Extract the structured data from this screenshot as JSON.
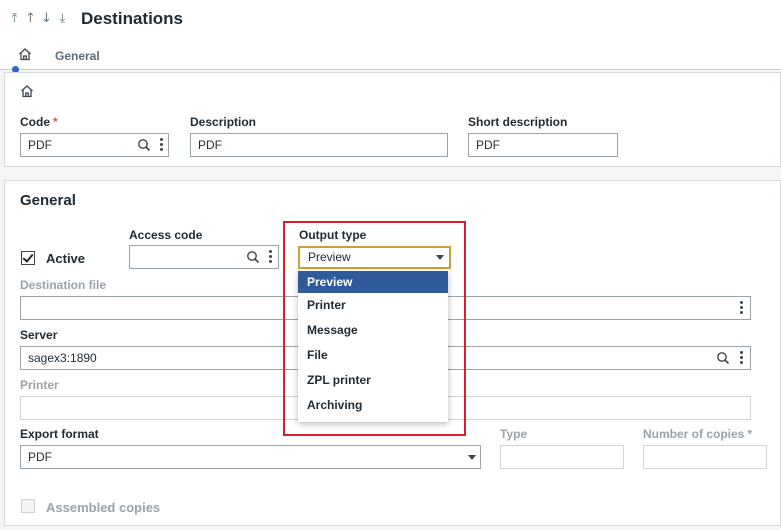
{
  "header": {
    "title": "Destinations",
    "nav_icons": [
      "first-record-icon",
      "previous-record-icon",
      "next-record-icon",
      "last-record-icon"
    ]
  },
  "tabs": {
    "home_icon": "home-icon",
    "general_label": "General"
  },
  "header_card": {
    "home_icon": "home-icon",
    "code": {
      "label": "Code",
      "required_mark": "*",
      "value": "PDF"
    },
    "description": {
      "label": "Description",
      "value": "PDF"
    },
    "short_description": {
      "label": "Short description",
      "value": "PDF"
    }
  },
  "general": {
    "title": "General",
    "active": {
      "label": "Active",
      "checked": true
    },
    "access_code": {
      "label": "Access code",
      "value": ""
    },
    "output_type": {
      "label": "Output type",
      "value": "Preview",
      "options": [
        "Preview",
        "Printer",
        "Message",
        "File",
        "ZPL printer",
        "Archiving"
      ],
      "selected_index": 0
    },
    "destination_file": {
      "label": "Destination file",
      "value": ""
    },
    "server": {
      "label": "Server",
      "value": "sagex3:1890"
    },
    "printer": {
      "label": "Printer",
      "value": ""
    },
    "export_format": {
      "label": "Export format",
      "value": "PDF"
    },
    "type": {
      "label": "Type",
      "value": ""
    },
    "number_of_copies": {
      "label": "Number of copies",
      "required_mark": "*",
      "value": ""
    },
    "assembled_copies": {
      "label": "Assembled copies",
      "checked": false
    }
  },
  "colors": {
    "accent_blue": "#2f69c4",
    "selected_option": "#2f5a9c",
    "required": "#e1582a",
    "highlight_box": "#d6202d",
    "focus_border": "#c8a13b"
  }
}
